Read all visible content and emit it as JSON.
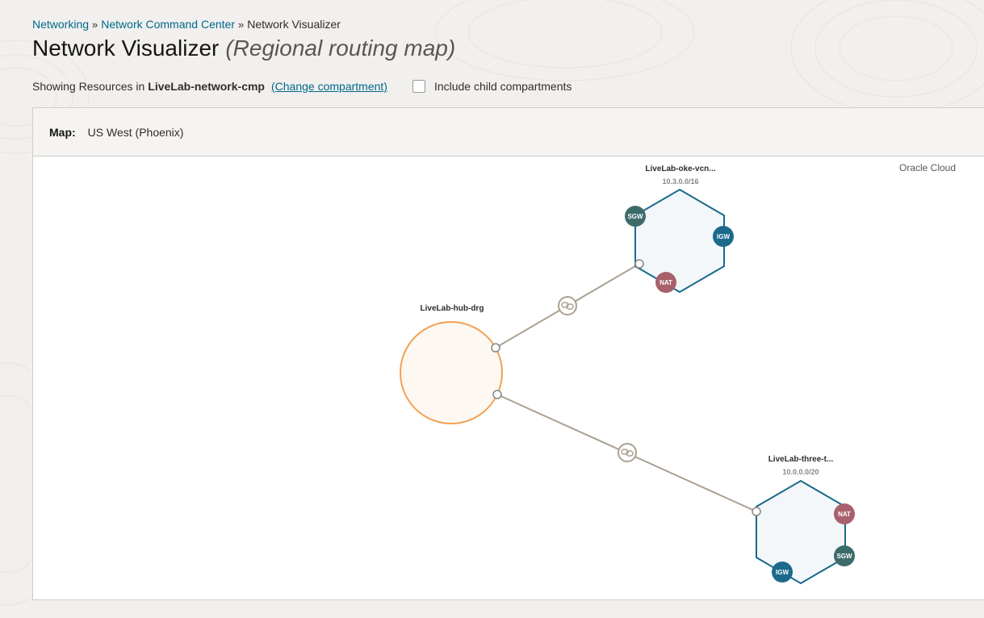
{
  "breadcrumb": {
    "items": [
      "Networking",
      "Network Command Center",
      "Network Visualizer"
    ],
    "separator": "»"
  },
  "page": {
    "title": "Network Visualizer",
    "subtitle": "(Regional routing map)"
  },
  "compartment": {
    "prefix": "Showing Resources in",
    "name": "LiveLab-network-cmp",
    "change_link": "(Change compartment)",
    "include_child_label": "Include child compartments",
    "include_child_checked": false
  },
  "map": {
    "label": "Map:",
    "region": "US West (Phoenix)",
    "cloud_label": "Oracle Cloud",
    "drg": {
      "name": "LiveLab-hub-drg"
    },
    "vcns": [
      {
        "name": "LiveLab-oke-vcn...",
        "cidr": "10.3.0.0/16",
        "gateways": [
          "SGW",
          "IGW",
          "NAT"
        ]
      },
      {
        "name": "LiveLab-three-t...",
        "cidr": "10.0.0.0/20",
        "gateways": [
          "NAT",
          "SGW",
          "IGW"
        ]
      }
    ],
    "colors": {
      "vcn_stroke": "#1b6a8c",
      "vcn_fill": "#f3f7fa",
      "drg_stroke": "#f1a153",
      "drg_fill": "#fef8f2",
      "link": "#aaa190",
      "sgw": "#3d6b6b",
      "igw": "#1b6a8c",
      "nat": "#a8616b"
    }
  }
}
